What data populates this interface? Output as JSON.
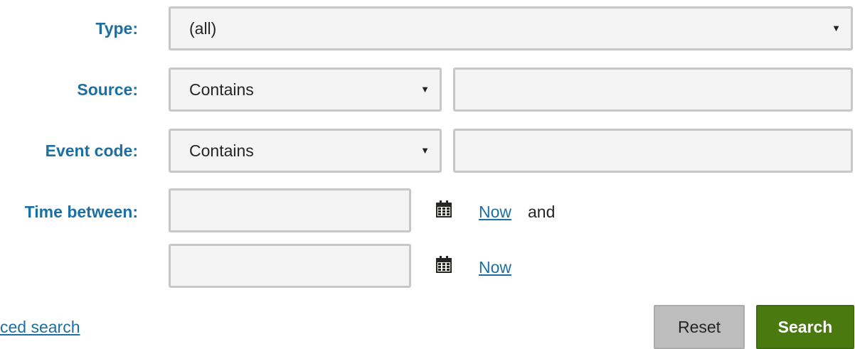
{
  "filters": {
    "type": {
      "label": "Type:",
      "selected": "(all)"
    },
    "source": {
      "label": "Source:",
      "operator": "Contains",
      "value": ""
    },
    "event_code": {
      "label": "Event code:",
      "operator": "Contains",
      "value": ""
    },
    "time_between": {
      "label": "Time between:",
      "from_value": "",
      "from_now_link": "Now",
      "and_text": "and",
      "to_value": "",
      "to_now_link": "Now"
    }
  },
  "advanced_search_link": "ced search",
  "buttons": {
    "reset": "Reset",
    "search": "Search"
  },
  "icons": {
    "dropdown": "caret-down-icon",
    "calendar": "calendar-icon"
  },
  "colors": {
    "label": "#1c6fa3",
    "link": "#1c6fa3",
    "search_button": "#4a7a0f",
    "reset_button": "#bdbdbd",
    "field_bg": "#f4f4f4",
    "field_border": "#c7c7c7"
  }
}
